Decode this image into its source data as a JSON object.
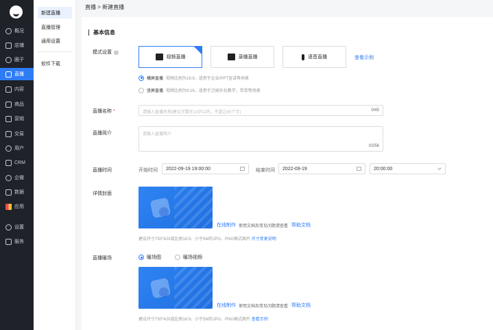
{
  "nav": {
    "items": [
      {
        "label": "概况",
        "icon": "clock-icon"
      },
      {
        "label": "店铺",
        "icon": "store-icon"
      },
      {
        "label": "圈子",
        "icon": "circle-icon"
      },
      {
        "label": "直播",
        "icon": "live-icon"
      },
      {
        "label": "内容",
        "icon": "document-icon"
      },
      {
        "label": "商品",
        "icon": "goods-icon"
      },
      {
        "label": "营销",
        "icon": "megaphone-icon"
      },
      {
        "label": "交易",
        "icon": "trade-icon"
      },
      {
        "label": "用户",
        "icon": "user-icon"
      },
      {
        "label": "CRM",
        "icon": "crm-icon"
      },
      {
        "label": "企微",
        "icon": "wecom-icon"
      },
      {
        "label": "数据",
        "icon": "data-icon"
      },
      {
        "label": "应用",
        "icon": "apps-icon"
      },
      {
        "label": "设置",
        "icon": "gear-icon"
      },
      {
        "label": "服务",
        "icon": "service-icon"
      }
    ],
    "active": "直播",
    "accent": "#2d7cf6"
  },
  "subnav": {
    "items": [
      "新建直播",
      "直播管理",
      "通用设置",
      "软件下载"
    ]
  },
  "breadcrumb": "直播 > 新建直播",
  "section_title": "基本信息",
  "mode": {
    "label": "模式设置",
    "options": [
      "视频直播",
      "录播直播",
      "语音直播"
    ],
    "selected": "视频直播",
    "example_link": "查看示例"
  },
  "orientation": {
    "landscape": {
      "label": "横屏直播",
      "desc": "视频比例为16:9，适用于企业/PPT宣讲等场景"
    },
    "portrait": {
      "label": "竖屏直播",
      "desc": "视频比例为9:16，适用于泛娱乐化教学、带货等场景"
    }
  },
  "name": {
    "label": "直播名称",
    "placeholder": "请输入直播名称(建议字数在14字以内，不超过45个字)",
    "count": "0/45"
  },
  "intro": {
    "label": "直播简介",
    "placeholder": "请输入直播简介",
    "count": "0/256"
  },
  "time": {
    "label": "直播时间",
    "start_label": "开始时间",
    "start_value": "2022-09-19 19:00:00",
    "end_label": "结束时间",
    "end_date": "2022-09-19",
    "end_time": "20:00:00"
  },
  "cover": {
    "label": "详情封面",
    "online_make": "在线制作",
    "online_desc": "使用文档及常见问题请查看",
    "help": "帮助文档",
    "hint": "建议尺寸750*420或比例16:9，小于5M的JPG、PNG格式图片",
    "size_link": "尺寸变更说明"
  },
  "warmup": {
    "label": "直播暖场",
    "options": [
      "暖场图",
      "暖场视频"
    ],
    "selected": "暖场图",
    "online_make": "在线制作",
    "online_desc": "使用文档及常见问题请查看",
    "help": "帮助文档",
    "hint": "建议尺寸750*420或比例16:9，小于5M的JPG、PNG格式图片",
    "example_link": "查看示例"
  }
}
